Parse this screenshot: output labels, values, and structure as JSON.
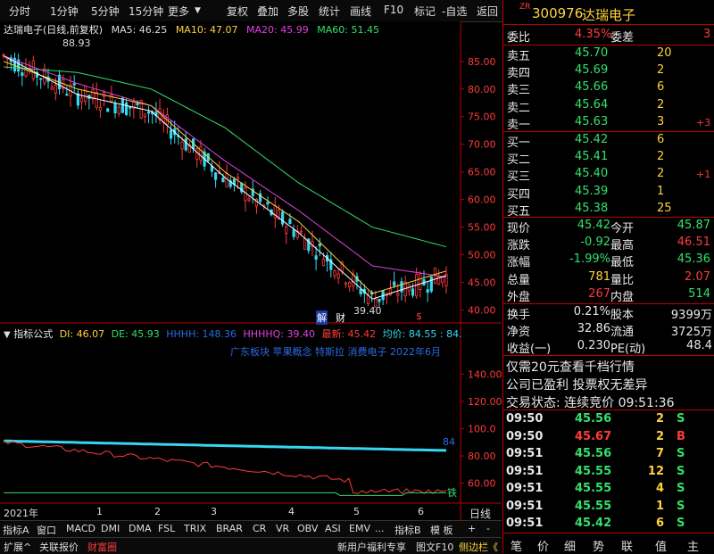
{
  "toolbar": {
    "left_items": [
      "分时",
      "1分钟",
      "5分钟",
      "15分钟",
      "更多"
    ],
    "right_items": [
      "复权",
      "叠加",
      "多股",
      "统计",
      "画线",
      "F10",
      "标记",
      "-自选",
      "返回"
    ]
  },
  "stock": {
    "code": "300976",
    "name": "达瑞电子",
    "badge": "ZR"
  },
  "main_header": {
    "title": "达瑞电子(日线,前复权)",
    "ma5": "MA5: 46.25",
    "ma10": "MA10: 47.07",
    "ma20": "MA20: 45.99",
    "ma60": "MA60: 51.45"
  },
  "price_axis": [
    "85.00",
    "80.00",
    "75.00",
    "70.00",
    "65.00",
    "60.00",
    "55.00",
    "50.00",
    "45.00",
    "40.00"
  ],
  "annotations": {
    "high": "88.93",
    "low": "39.40",
    "jie": "解",
    "cai": "财",
    "dollar": "$"
  },
  "indicator_header": {
    "label": "指标公式",
    "di": "DI: 46.07",
    "de": "DE: 45.93",
    "hhhh": "HHHH: 148.36",
    "hhhhq": "HHHHQ: 39.40",
    "latest": "最新: 45.42",
    "avg": "均价: 84.55 : 84."
  },
  "indicator_sub": {
    "text": "广东板块 苹果概念 特斯拉 消费电子 2022年6月"
  },
  "indicator_axis": [
    "140.00",
    "120.00",
    "100.0",
    "80.00",
    "60.00"
  ],
  "indicator_marks": {
    "val84": "84",
    "tie": "铁"
  },
  "time_axis": [
    "2021年",
    "1",
    "2",
    "3",
    "4",
    "5",
    "6"
  ],
  "time_axis_right": "日线",
  "bottom_tabs": [
    "指标A",
    "窗口",
    "MACD",
    "DMI",
    "DMA",
    "FSL",
    "TRIX",
    "BRAR",
    "CR",
    "VR",
    "OBV",
    "ASI",
    "EMV",
    "..."
  ],
  "bottom_tabs_right": [
    "指标B",
    "模 板",
    "+",
    "-"
  ],
  "status_bar": {
    "left": [
      "扩展^",
      "关联报价",
      "财富圈"
    ],
    "right": [
      "新用户福利专享",
      "图文F10",
      "侧边栏《"
    ]
  },
  "right_nav": [
    "笔",
    "价",
    "细",
    "势",
    "联",
    "值",
    "主"
  ],
  "weibi": {
    "label1": "委比",
    "val1": "4.35%",
    "label2": "委差",
    "val2": "3"
  },
  "sell": [
    {
      "label": "卖五",
      "price": "45.70",
      "vol": "20",
      "chg": ""
    },
    {
      "label": "卖四",
      "price": "45.69",
      "vol": "2",
      "chg": ""
    },
    {
      "label": "卖三",
      "price": "45.66",
      "vol": "6",
      "chg": ""
    },
    {
      "label": "卖二",
      "price": "45.64",
      "vol": "2",
      "chg": ""
    },
    {
      "label": "卖一",
      "price": "45.63",
      "vol": "3",
      "chg": "+3"
    }
  ],
  "buy": [
    {
      "label": "买一",
      "price": "45.42",
      "vol": "6",
      "chg": ""
    },
    {
      "label": "买二",
      "price": "45.41",
      "vol": "2",
      "chg": ""
    },
    {
      "label": "买三",
      "price": "45.40",
      "vol": "2",
      "chg": "+1"
    },
    {
      "label": "买四",
      "price": "45.39",
      "vol": "1",
      "chg": ""
    },
    {
      "label": "买五",
      "price": "45.38",
      "vol": "25",
      "chg": ""
    }
  ],
  "quote": [
    {
      "l1": "现价",
      "v1": "45.42",
      "l2": "今开",
      "v2": "45.87"
    },
    {
      "l1": "涨跌",
      "v1": "-0.92",
      "l2": "最高",
      "v2": "46.51"
    },
    {
      "l1": "涨幅",
      "v1": "-1.99%",
      "l2": "最低",
      "v2": "45.36"
    },
    {
      "l1": "总量",
      "v1": "781",
      "l2": "量比",
      "v2": "2.07"
    },
    {
      "l1": "外盘",
      "v1": "267",
      "l2": "内盘",
      "v2": "514"
    }
  ],
  "stats": [
    {
      "l1": "换手",
      "v1": "0.21%",
      "l2": "股本",
      "v2": "9399万"
    },
    {
      "l1": "净资",
      "v1": "32.86",
      "l2": "流通",
      "v2": "3725万"
    },
    {
      "l1": "收益(一)",
      "v1": "0.230",
      "l2": "PE(动)",
      "v2": "48.4"
    }
  ],
  "promo": {
    "line1": "仅需20元查看千档行情",
    "line2": "公司已盈利 投票权无差异",
    "line3": "交易状态: 连续竞价 09:51:36"
  },
  "ticks": [
    {
      "time": "09:50",
      "price": "45.56",
      "vol": "2",
      "side": "S"
    },
    {
      "time": "09:50",
      "price": "45.67",
      "vol": "2",
      "side": "B"
    },
    {
      "time": "09:51",
      "price": "45.56",
      "vol": "7",
      "side": "S"
    },
    {
      "time": "09:51",
      "price": "45.55",
      "vol": "12",
      "side": "S"
    },
    {
      "time": "09:51",
      "price": "45.55",
      "vol": "4",
      "side": "S"
    },
    {
      "time": "09:51",
      "price": "45.55",
      "vol": "1",
      "side": "S"
    },
    {
      "time": "09:51",
      "price": "45.42",
      "vol": "6",
      "side": "S"
    }
  ],
  "colors": {
    "up": "#ff3b3b",
    "down": "#34e06b",
    "ma5": "#ffffff",
    "ma10": "#ffd23c",
    "ma20": "#e040e0",
    "ma60": "#34e06b",
    "accent": "#b00000"
  },
  "chart_data": {
    "type": "line",
    "title": "达瑞电子(日线,前复权)",
    "x": [
      "2021年",
      "1",
      "2",
      "3",
      "4",
      "5",
      "6"
    ],
    "series": [
      {
        "name": "MA60",
        "values": [
          84,
          83,
          80,
          73,
          63,
          55,
          51.45
        ]
      },
      {
        "name": "MA20",
        "values": [
          86,
          81,
          77,
          67,
          58,
          48,
          45.99
        ]
      },
      {
        "name": "MA10",
        "values": [
          85,
          80,
          77,
          65,
          56,
          43,
          47.07
        ]
      },
      {
        "name": "MA5",
        "values": [
          86,
          79,
          76,
          64,
          54,
          42,
          46.25
        ]
      }
    ],
    "ylim": [
      38,
      89
    ]
  }
}
